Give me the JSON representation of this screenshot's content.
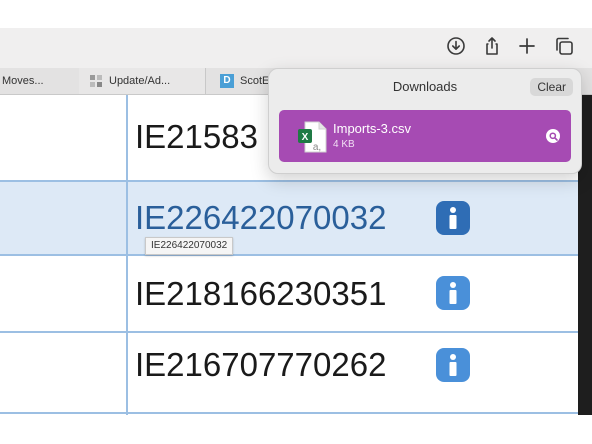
{
  "toolbar": {
    "buttons": [
      "downloads-icon",
      "share-icon",
      "new-tab-icon",
      "tab-overview-icon"
    ]
  },
  "tabs": [
    {
      "label": "Moves..."
    },
    {
      "label": "Update/Ad..."
    },
    {
      "label": "ScotE",
      "favicon_letter": "D"
    }
  ],
  "table": {
    "rows": [
      {
        "id": "IE21583",
        "selected": false
      },
      {
        "id": "IE226422070032",
        "selected": true
      },
      {
        "id": "IE218166230351",
        "selected": false
      },
      {
        "id": "IE216707770262",
        "selected": false
      }
    ],
    "info_glyph": "i",
    "tooltip": "IE226422070032"
  },
  "downloads": {
    "title": "Downloads",
    "clear_label": "Clear",
    "item": {
      "name": "Imports-3.csv",
      "size": "4 KB",
      "icon_letters": "X",
      "icon_sub": "a,"
    }
  },
  "colors": {
    "download_item_bg": "#a64bb3",
    "row_selected_bg": "#dde9f6",
    "grid_line": "#9cbfe3",
    "info_button": "#4a90d9"
  }
}
